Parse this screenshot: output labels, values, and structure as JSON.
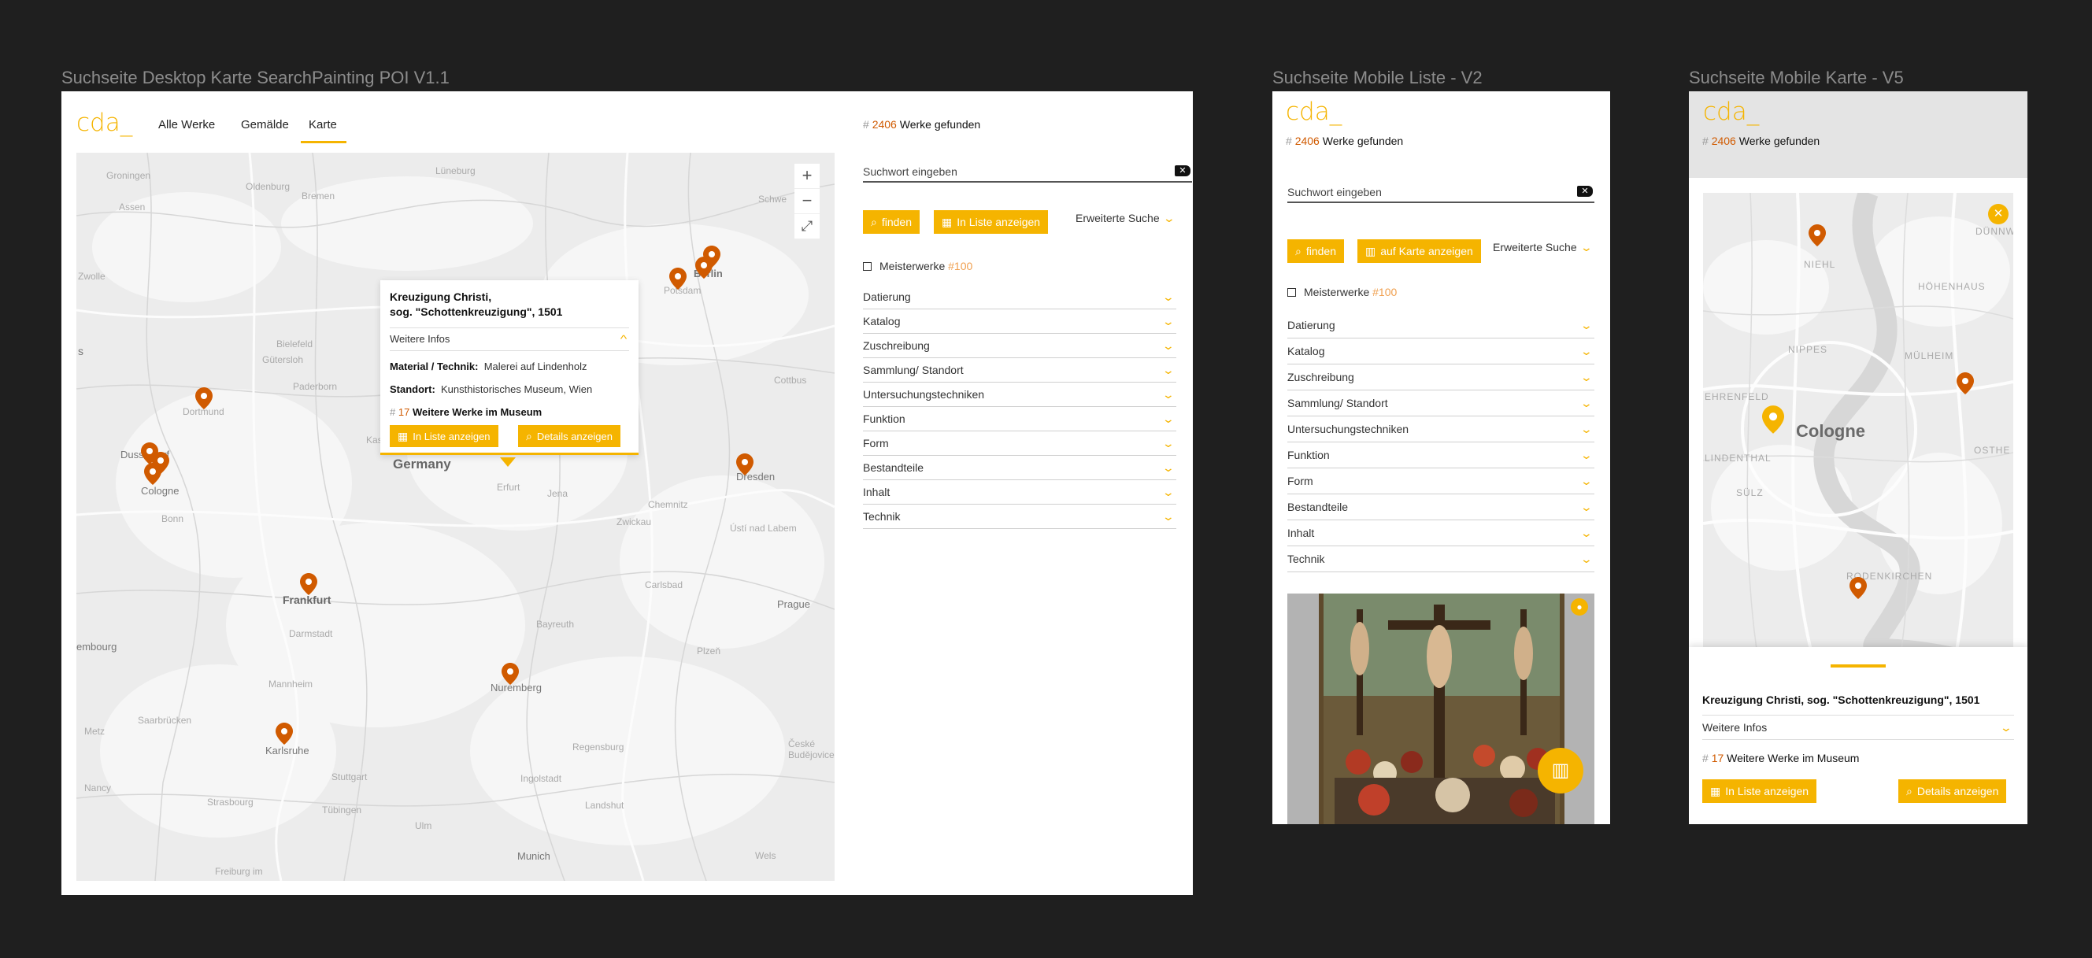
{
  "frames": {
    "desktop_title": "Suchseite Desktop Karte SearchPainting POI V1.1",
    "mobile_list_title": "Suchseite Mobile Liste - V2",
    "mobile_map_title": "Suchseite Mobile Karte - V5"
  },
  "brand": {
    "logo": "cda_",
    "accent": "#f5b400",
    "pin_color": "#d05a00"
  },
  "desktop": {
    "nav": {
      "all": "Alle Werke",
      "paintings": "Gemälde",
      "map": "Karte"
    },
    "results": {
      "hash": "#",
      "count": "2406",
      "label": "Werke gefunden"
    },
    "search": {
      "placeholder": "Suchwort eingeben"
    },
    "buttons": {
      "find": "finden",
      "list": "In Liste anzeigen",
      "advanced": "Erweiterte Suche"
    },
    "masterworks": {
      "label": "Meisterwerke",
      "count": "#100"
    },
    "filters": [
      "Datierung",
      "Katalog",
      "Zuschreibung",
      "Sammlung/ Standort",
      "Untersuchungstechniken",
      "Funktion",
      "Form",
      "Bestandteile",
      "Inhalt",
      "Technik"
    ],
    "map_labels": {
      "groningen": "Groningen",
      "oldenburg": "Oldenburg",
      "bremen": "Bremen",
      "luneburg": "Lüneburg",
      "assen": "Assen",
      "zwolle": "Zwolle",
      "potsdam": "Potsdam",
      "berlin": "Berlin",
      "bielefeld": "Bielefeld",
      "gutersloh": "Gütersloh",
      "paderborn": "Paderborn",
      "dortmund": "Dortmund",
      "dusseldorf": "Dusseldorf",
      "cologne": "Cologne",
      "bonn": "Bonn",
      "germany": "Germany",
      "erfurt": "Erfurt",
      "jena": "Jena",
      "chemnitz": "Chemnitz",
      "dresden": "Dresden",
      "zwickau": "Zwickau",
      "usti": "Ústí nad Labem",
      "frankfurt": "Frankfurt",
      "darmstadt": "Darmstadt",
      "karlsbad": "Carlsbad",
      "prague": "Prague",
      "bayreuth": "Bayreuth",
      "plzen": "Plzeň",
      "luxembourg": "embourg",
      "mannheim": "Mannheim",
      "nuremberg": "Nuremberg",
      "saarbrucken": "Saarbrücken",
      "metz": "Metz",
      "karlsruhe": "Karlsruhe",
      "regensburg": "Regensburg",
      "ceske": "České\nBudějovice",
      "stuttgart": "Stuttgart",
      "ingolstadt": "Ingolstadt",
      "nancy": "Nancy",
      "strasbourg": "Strasbourg",
      "tubingen": "Tübingen",
      "landshut": "Landshut",
      "ulm": "Ulm",
      "munich": "Munich",
      "freiburg": "Freiburg im",
      "wels": "Wels",
      "cottbus": "Cottbus",
      "kassel": "Kas",
      "s": "s",
      "schwerin": "Schwe"
    },
    "popup": {
      "title_line1": "Kreuzigung Christi,",
      "title_line2": "sog. \"Schottenkreuzigung\", 1501",
      "more_info": "Weitere Infos",
      "material_label": "Material / Technik:",
      "material_value": "Malerei auf Lindenholz",
      "location_label": "Standort:",
      "location_value": "Kunsthistorisches Museum, Wien",
      "more_hash": "#",
      "more_count": "17",
      "more_label": "Weitere Werke im Museum",
      "btn_list": "In Liste anzeigen",
      "btn_details": "Details anzeigen"
    },
    "zoom": {
      "in": "+",
      "out": "−",
      "full": "⤢"
    }
  },
  "mobile_list": {
    "results": {
      "hash": "#",
      "count": "2406",
      "label": "Werke gefunden"
    },
    "search": {
      "placeholder": "Suchwort eingeben"
    },
    "buttons": {
      "find": "finden",
      "map": "auf Karte anzeigen",
      "advanced": "Erweiterte Suche"
    },
    "masterworks": {
      "label": "Meisterwerke",
      "count": "#100"
    },
    "filters": [
      "Datierung",
      "Katalog",
      "Zuschreibung",
      "Sammlung/ Standort",
      "Untersuchungstechniken",
      "Funktion",
      "Form",
      "Bestandteile",
      "Inhalt",
      "Technik"
    ]
  },
  "mobile_map": {
    "results": {
      "hash": "#",
      "count": "2406",
      "label": "Werke gefunden"
    },
    "map_labels": {
      "niehl": "NIEHL",
      "dunnwald": "DÜNNWAL",
      "hohenhaus": "HÖHENHAUS",
      "nippes": "NIPPES",
      "mulheim": "MÜLHEIM",
      "ehrenfeld": "EHRENFELD",
      "cologne": "Cologne",
      "lindenthal": "LINDENTHAL",
      "osthe": "OSTHE",
      "sulz": "SÜLZ",
      "rodenkirchen": "RODENKIRCHEN"
    },
    "card": {
      "title": "Kreuzigung Christi, sog. \"Schottenkreuzigung\", 1501",
      "more_info": "Weitere Infos",
      "more_hash": "#",
      "more_count": "17",
      "more_label": "Weitere Werke im Museum",
      "btn_list": "In Liste anzeigen",
      "btn_details": "Details anzeigen"
    }
  }
}
